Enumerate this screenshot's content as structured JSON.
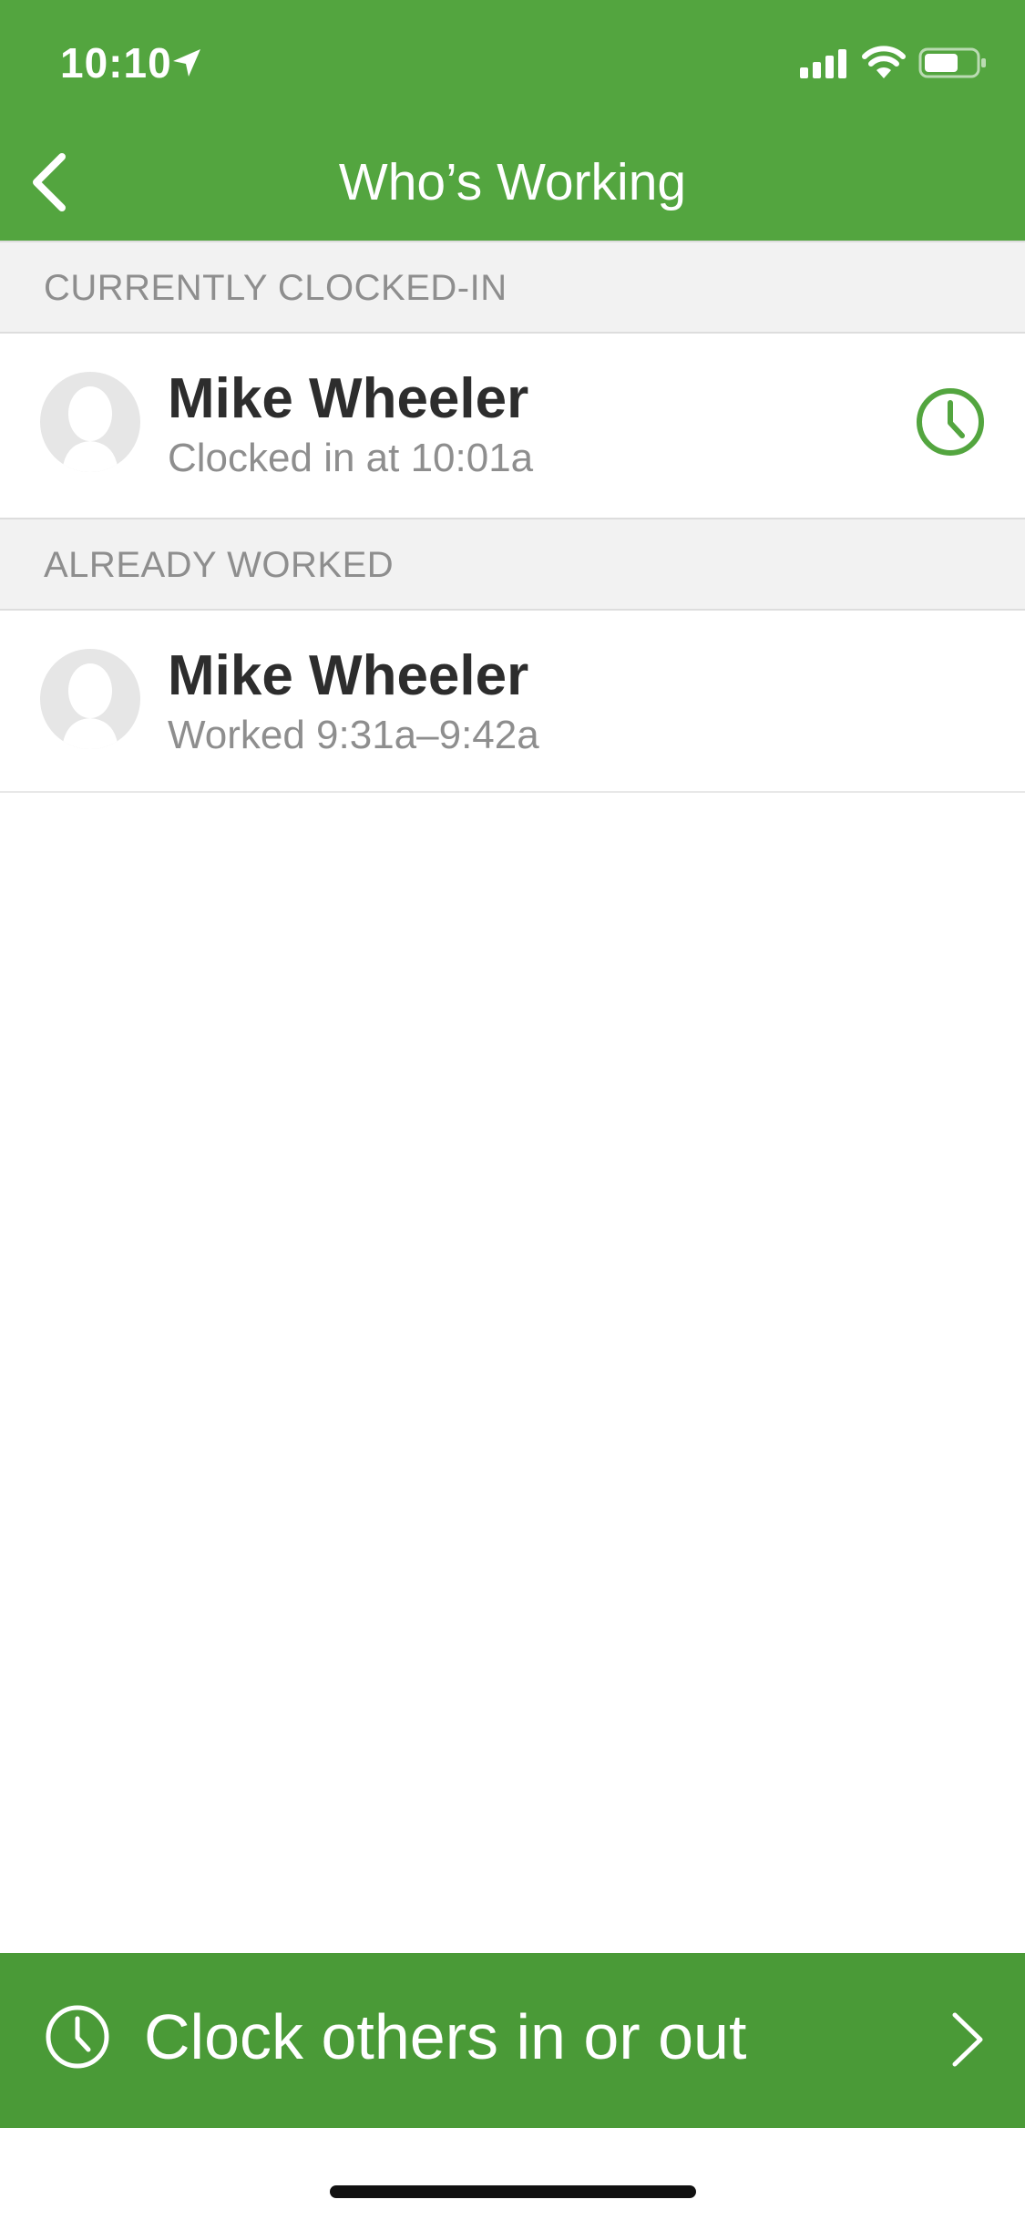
{
  "status_bar": {
    "time": "10:10"
  },
  "nav": {
    "title": "Who’s Working"
  },
  "sections": [
    {
      "header": "CURRENTLY CLOCKED-IN",
      "rows": [
        {
          "name": "Mike Wheeler",
          "detail": "Clocked in at 10:01a"
        }
      ]
    },
    {
      "header": "ALREADY WORKED",
      "rows": [
        {
          "name": "Mike Wheeler",
          "detail": "Worked 9:31a–9:42a"
        }
      ]
    }
  ],
  "bottom_action": {
    "label": "Clock others in or out"
  },
  "colors": {
    "brand_green": "#53a53f",
    "action_green": "#4a9a37"
  }
}
